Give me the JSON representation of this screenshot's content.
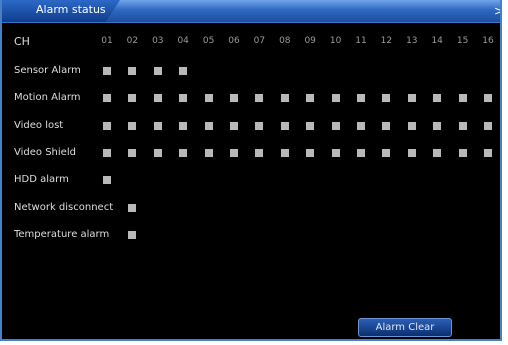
{
  "window": {
    "title": "Alarm status",
    "close_glyph": ">"
  },
  "header": {
    "ch_label": "CH",
    "channels": [
      "01",
      "02",
      "03",
      "04",
      "05",
      "06",
      "07",
      "08",
      "09",
      "10",
      "11",
      "12",
      "13",
      "14",
      "15",
      "16"
    ]
  },
  "rows": [
    {
      "label": "Sensor Alarm",
      "indicators": [
        1,
        2,
        3,
        4
      ]
    },
    {
      "label": "Motion Alarm",
      "indicators": [
        1,
        2,
        3,
        4,
        5,
        6,
        7,
        8,
        9,
        10,
        11,
        12,
        13,
        14,
        15,
        16
      ]
    },
    {
      "label": "Video lost",
      "indicators": [
        1,
        2,
        3,
        4,
        5,
        6,
        7,
        8,
        9,
        10,
        11,
        12,
        13,
        14,
        15,
        16
      ]
    },
    {
      "label": "Video Shield",
      "indicators": [
        1,
        2,
        3,
        4,
        5,
        6,
        7,
        8,
        9,
        10,
        11,
        12,
        13,
        14,
        15,
        16
      ]
    },
    {
      "label": "HDD alarm",
      "indicators": [
        1
      ]
    },
    {
      "label": "Network disconnect",
      "indicators": [
        2
      ]
    },
    {
      "label": "Temperature alarm",
      "indicators": [
        2
      ]
    }
  ],
  "footer": {
    "clear_button_label": "Alarm Clear"
  },
  "colors": {
    "background": "#000000",
    "title_bar": "#2f68bf",
    "indicator": "#b9b9b9",
    "text": "#dddddd"
  }
}
